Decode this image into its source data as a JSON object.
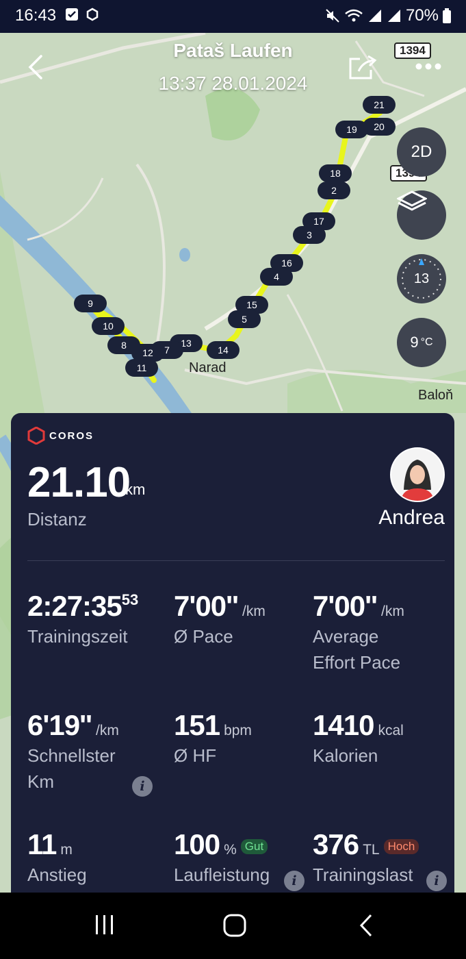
{
  "status_bar": {
    "time": "16:43",
    "battery": "70%"
  },
  "header": {
    "title": "Pataš Laufen",
    "datetime": "13:37 28.01.2024"
  },
  "map": {
    "road_badge_1": "1394",
    "road_badge_2": "1394",
    "view_toggle": "2D",
    "compass_value": "13",
    "temperature": "9",
    "temperature_unit": "°C",
    "places": [
      "Narad",
      "Baloň"
    ],
    "km_markers": [
      "21",
      "20",
      "19",
      "18",
      "2",
      "17",
      "3",
      "16",
      "4",
      "15",
      "5",
      "14",
      "13",
      "7",
      "12",
      "8",
      "11",
      "10",
      "9"
    ]
  },
  "card": {
    "brand": "COROS",
    "distance_value": "21.10",
    "distance_unit": "km",
    "distance_label": "Distanz",
    "user_name": "Andrea",
    "metrics": {
      "time": {
        "value": "2:27:35",
        "sup": "53",
        "label": "Trainingszeit"
      },
      "pace": {
        "value": "7'00''",
        "unit": "/km",
        "label": "Ø Pace"
      },
      "effort_pace": {
        "value": "7'00''",
        "unit": "/km",
        "label1": "Average",
        "label2": "Effort Pace"
      },
      "fastest_km": {
        "value": "6'19''",
        "unit": "/km",
        "label1": "Schnellster",
        "label2": "Km"
      },
      "hr": {
        "value": "151",
        "unit": "bpm",
        "label": "Ø HF"
      },
      "calories": {
        "value": "1410",
        "unit": "kcal",
        "label": "Kalorien"
      },
      "ascent": {
        "value": "11",
        "unit": "m",
        "label": "Anstieg"
      },
      "run_performance": {
        "value": "100",
        "unit": "%",
        "badge": "Gut",
        "label": "Laufleistung"
      },
      "training_load": {
        "value": "376",
        "unit": "TL",
        "badge": "Hoch",
        "label": "Trainingslast"
      }
    }
  },
  "colors": {
    "card_bg": "#1b1f38",
    "route": "#e8f51c",
    "badge_good": "#2e9e4f",
    "badge_high": "#d5553b"
  }
}
